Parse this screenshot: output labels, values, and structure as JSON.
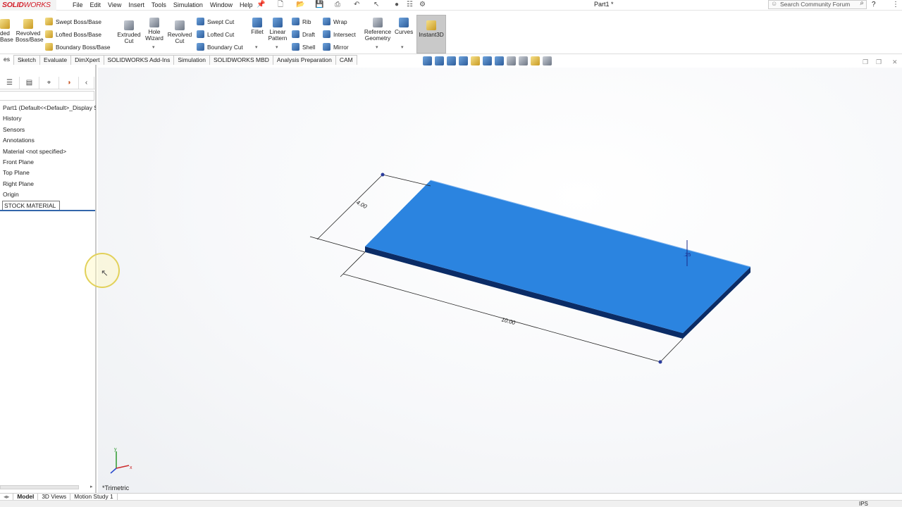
{
  "app": {
    "logo_a": "SOLID",
    "logo_b": "WORKS",
    "doc_title": "Part1 *"
  },
  "menu": [
    "File",
    "Edit",
    "View",
    "Insert",
    "Tools",
    "Simulation",
    "Window",
    "Help"
  ],
  "search": {
    "placeholder": "Search Community Forum"
  },
  "ribbon": {
    "extruded_base": "ded\nBase",
    "revolved_base": "Revolved\nBoss/Base",
    "swept_boss": "Swept Boss/Base",
    "lofted_boss": "Lofted Boss/Base",
    "boundary_boss": "Boundary Boss/Base",
    "extruded_cut": "Extruded\nCut",
    "hole_wizard": "Hole\nWizard",
    "revolved_cut": "Revolved\nCut",
    "swept_cut": "Swept Cut",
    "lofted_cut": "Lofted Cut",
    "boundary_cut": "Boundary Cut",
    "fillet": "Fillet",
    "linear_pattern": "Linear\nPattern",
    "rib": "Rib",
    "draft": "Draft",
    "shell": "Shell",
    "wrap": "Wrap",
    "intersect": "Intersect",
    "mirror": "Mirror",
    "reference_geometry": "Reference\nGeometry",
    "curves": "Curves",
    "instant3d": "Instant3D"
  },
  "tabs": [
    "es",
    "Sketch",
    "Evaluate",
    "DimXpert",
    "SOLIDWORKS Add-Ins",
    "Simulation",
    "SOLIDWORKS MBD",
    "Analysis Preparation",
    "CAM"
  ],
  "tree": {
    "root": "Part1  (Default<<Default>_Display S",
    "items": [
      "History",
      "Sensors",
      "Annotations",
      "Material <not specified>",
      "Front Plane",
      "Top Plane",
      "Right Plane",
      "Origin"
    ],
    "editing": "STOCK MATERIAL"
  },
  "model": {
    "dim_width": "4.00",
    "dim_length": "10.00",
    "dim_thickness": ".25",
    "color_top": "#2b84e0",
    "color_side": "#0b2c66"
  },
  "triad": {
    "x": "x",
    "y": "y"
  },
  "view_orientation": "*Trimetric",
  "bottom_tabs": [
    "Model",
    "3D Views",
    "Motion Study 1"
  ],
  "status": {
    "units": "IPS"
  }
}
